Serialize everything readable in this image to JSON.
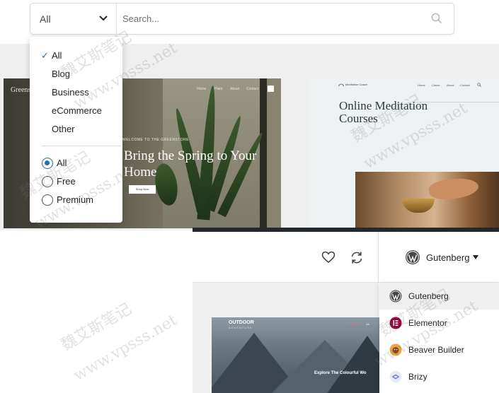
{
  "filter": {
    "type_value": "All",
    "search_placeholder": "Search..."
  },
  "type_dropdown": {
    "categories": [
      "All",
      "Blog",
      "Business",
      "eCommerce",
      "Other"
    ],
    "selected_category": "All",
    "pricing": [
      {
        "label": "All",
        "checked": true
      },
      {
        "label": "Free",
        "checked": false
      },
      {
        "label": "Premium",
        "checked": false
      }
    ]
  },
  "cards": {
    "greens": {
      "brand": "Greens",
      "nav": [
        "Home",
        "Plant",
        "About",
        "Contact"
      ],
      "welcome": "WELCOME TO THE GREENSTORE",
      "headline": "Bring the Spring to Your Home",
      "button": "Shop Now"
    },
    "meditation": {
      "logo": "Meditation Coach",
      "nav": [
        "Home",
        "Cases",
        "About",
        "Contact"
      ],
      "headline": "Online Meditation Courses"
    },
    "outdoor": {
      "brand": "OUTDOOR",
      "brand_sub": "ADVENTURE",
      "nav": [
        "Home",
        "Ab"
      ],
      "cta": "Explore The Colourful Wo"
    }
  },
  "toolbar": {
    "builder_selected": "Gutenberg"
  },
  "builder_dropdown": {
    "items": [
      {
        "name": "Gutenberg",
        "icon": "wordpress-icon",
        "color": "#464646",
        "active": true
      },
      {
        "name": "Elementor",
        "icon": "elementor-icon",
        "color": "#92003b",
        "active": false
      },
      {
        "name": "Beaver Builder",
        "icon": "beaver-builder-icon",
        "color": "#f0a33f",
        "active": false
      },
      {
        "name": "Brizy",
        "icon": "brizy-icon",
        "color": "#6f7bd8",
        "active": false
      }
    ]
  },
  "watermark": {
    "cn": "魏艾斯笔记",
    "url": "www.vpsss.net"
  },
  "colors": {
    "accent": "#2271b1"
  }
}
